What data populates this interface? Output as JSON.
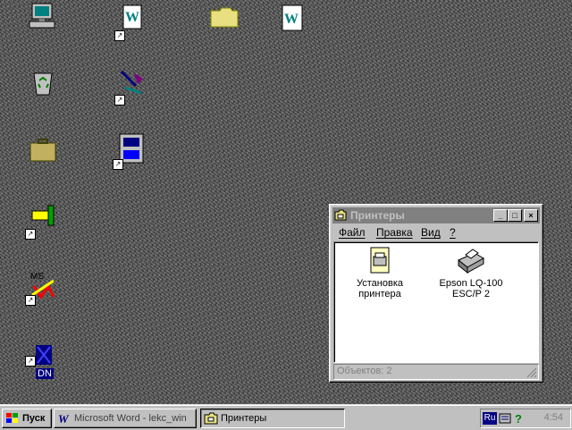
{
  "desktop": {
    "icons": [
      {
        "name": "my-computer-icon"
      },
      {
        "name": "word-document-shortcut-icon"
      },
      {
        "name": "folder-icon"
      },
      {
        "name": "word-document-icon"
      },
      {
        "name": "recycle-bin-icon"
      },
      {
        "name": "program-shortcut-icon"
      },
      {
        "name": "briefcase-folder-icon"
      },
      {
        "name": "calculator-shortcut-icon"
      },
      {
        "name": "tools-shortcut-icon"
      },
      {
        "name": "ms-office-shortcut-icon"
      },
      {
        "name": "dn-shortcut-icon"
      }
    ],
    "dn_label": "DN",
    "ms_label": "MS"
  },
  "window": {
    "title": "Принтеры",
    "menu": {
      "file": "Файл",
      "edit": "Правка",
      "view": "Вид",
      "help": "?"
    },
    "items": [
      {
        "label_line1": "Установка",
        "label_line2": "принтера",
        "icon": "add-printer-icon"
      },
      {
        "label_line1": "Epson LQ-100",
        "label_line2": "ESC/P 2",
        "icon": "printer-icon"
      }
    ],
    "status": "Объектов: 2",
    "controls": {
      "minimize": "_",
      "maximize": "□",
      "close": "×"
    }
  },
  "taskbar": {
    "start_label": "Пуск",
    "tasks": [
      {
        "label": "Microsoft Word - lekc_win",
        "active": false
      },
      {
        "label": "Принтеры",
        "active": true
      }
    ],
    "tray": {
      "language": "Ru",
      "clock": "4:54"
    }
  },
  "colors": {
    "desktop": "#5f5f5f",
    "inactive_title": "#808080",
    "window_face": "#c0c0c0"
  }
}
